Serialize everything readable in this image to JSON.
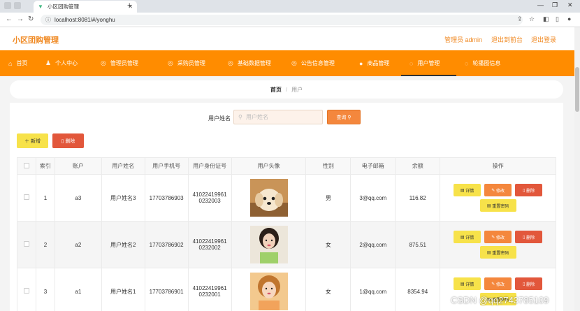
{
  "browser": {
    "tab_title": "小区团购管理",
    "url": "localhost:8081/#/yonghu"
  },
  "header": {
    "logo": "小区团购管理",
    "admin_label": "管理员 admin",
    "back_label": "退出到前台",
    "logout_label": "退出登录"
  },
  "nav": {
    "items": [
      {
        "label": "首页",
        "icon": "home-icon"
      },
      {
        "label": "个人中心",
        "icon": "person-icon"
      },
      {
        "label": "管理员管理",
        "icon": "admin-icon"
      },
      {
        "label": "采购员管理",
        "icon": "buyer-icon"
      },
      {
        "label": "基础数据管理",
        "icon": "data-icon"
      },
      {
        "label": "公告信息管理",
        "icon": "notice-icon"
      },
      {
        "label": "商品管理",
        "icon": "goods-icon"
      },
      {
        "label": "用户管理",
        "icon": "user-icon"
      },
      {
        "label": "轮播图信息",
        "icon": "carousel-icon"
      }
    ],
    "active_index": 7
  },
  "breadcrumb": {
    "home": "首页",
    "sep": "/",
    "current": "用户"
  },
  "search": {
    "label": "用户姓名",
    "placeholder": "用户姓名",
    "query_button": "查询"
  },
  "actions": {
    "add": "新增",
    "delete": "删除"
  },
  "table": {
    "headers": [
      "索引",
      "账户",
      "用户姓名",
      "用户手机号",
      "用户身份证号",
      "用户头像",
      "性别",
      "电子邮箱",
      "余额",
      "操作"
    ],
    "rows": [
      {
        "index": "1",
        "account": "a3",
        "name": "用户姓名3",
        "phone": "17703786903",
        "id_a": "41022419961",
        "id_b": "0232003",
        "gender": "男",
        "email": "3@qq.com",
        "balance": "116.82",
        "avatar_tone": "puppy"
      },
      {
        "index": "2",
        "account": "a2",
        "name": "用户姓名2",
        "phone": "17703786902",
        "id_a": "41022419961",
        "id_b": "0232002",
        "gender": "女",
        "email": "2@qq.com",
        "balance": "875.51",
        "avatar_tone": "girl-green"
      },
      {
        "index": "3",
        "account": "a1",
        "name": "用户姓名1",
        "phone": "17703786901",
        "id_a": "41022419961",
        "id_b": "0232001",
        "gender": "女",
        "email": "1@qq.com",
        "balance": "8354.94",
        "avatar_tone": "girl-warm"
      }
    ],
    "row_actions": {
      "detail": "详情",
      "edit": "修改",
      "delete": "删除",
      "reset": "重置密码"
    }
  },
  "watermark": "CSDN @qq2743785109",
  "colors": {
    "accent": "#ff8c00",
    "logo": "#f08a24",
    "yellow": "#f7e24a",
    "orange": "#f4873d",
    "red": "#e2573b"
  }
}
